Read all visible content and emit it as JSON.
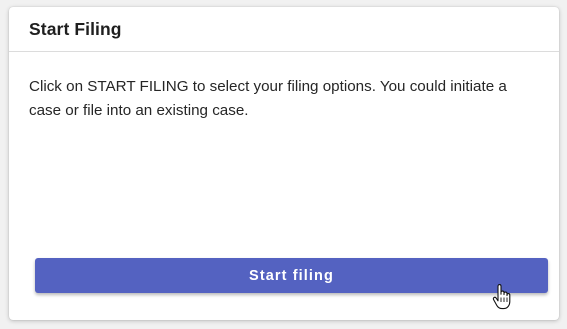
{
  "card": {
    "title": "Start Filing",
    "description": "Click on START FILING to select your filing options. You could initiate a case or file into an existing case.",
    "button_label": "Start filing"
  },
  "colors": {
    "button_bg": "#5462c1",
    "button_text": "#ffffff",
    "card_bg": "#ffffff"
  },
  "icons": {
    "cursor": "hand-pointer-cursor-icon"
  }
}
